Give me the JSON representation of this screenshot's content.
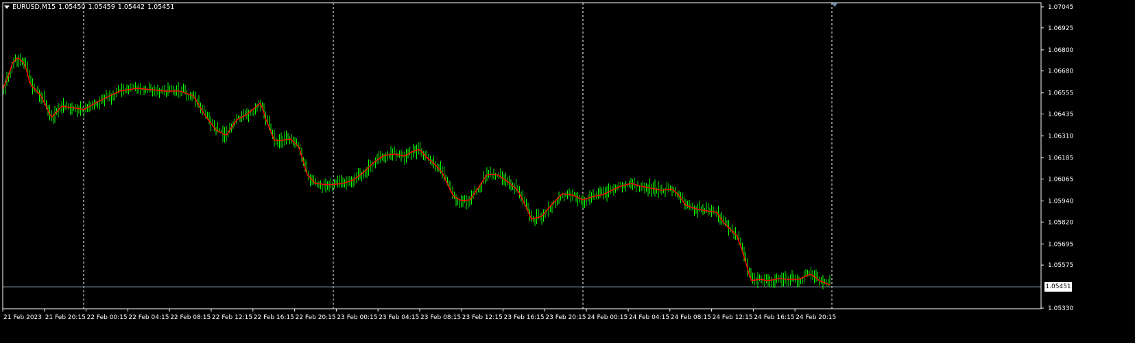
{
  "header": {
    "symbol": "EURUSD,M15",
    "open": "1.05450",
    "high": "1.05459",
    "low": "1.05442",
    "close": "1.05451"
  },
  "colors": {
    "background": "#000000",
    "candles": "#00ff00",
    "moving_average": "#ff0000",
    "grid": "#ffffff",
    "bid_line": "#778899"
  },
  "current_price": "1.05451",
  "price_axis": [
    "1.07045",
    "1.06925",
    "1.06800",
    "1.06680",
    "1.06555",
    "1.06435",
    "1.06310",
    "1.06185",
    "1.06065",
    "1.05940",
    "1.05820",
    "1.05695",
    "1.05575",
    "1.05451",
    "1.05330"
  ],
  "time_axis": [
    "21 Feb 2023",
    "21 Feb 20:15",
    "22 Feb 00:15",
    "22 Feb 04:15",
    "22 Feb 08:15",
    "22 Feb 12:15",
    "22 Feb 16:15",
    "22 Feb 20:15",
    "23 Feb 00:15",
    "23 Feb 04:15",
    "23 Feb 08:15",
    "23 Feb 12:15",
    "23 Feb 16:15",
    "23 Feb 20:15",
    "24 Feb 00:15",
    "24 Feb 04:15",
    "24 Feb 08:15",
    "24 Feb 12:15",
    "24 Feb 16:15",
    "24 Feb 20:15"
  ],
  "day_separators": [
    "22 Feb 00:00",
    "23 Feb 00:00",
    "24 Feb 00:00",
    "25 Feb 00:00"
  ],
  "chart_data": {
    "type": "line",
    "x": [
      "21 Feb 2023",
      "21 Feb 20:15",
      "22 Feb 00:15",
      "22 Feb 04:15",
      "22 Feb 08:15",
      "22 Feb 12:15",
      "22 Feb 16:15",
      "22 Feb 20:15",
      "23 Feb 00:15",
      "23 Feb 04:15",
      "23 Feb 08:15",
      "23 Feb 12:15",
      "23 Feb 16:15",
      "23 Feb 20:15",
      "24 Feb 00:15",
      "24 Feb 04:15",
      "24 Feb 08:15",
      "24 Feb 12:15",
      "24 Feb 16:15",
      "24 Feb 20:15"
    ],
    "series": [
      {
        "values": [
          1.0658,
          1.065,
          1.0645,
          1.0655,
          1.0657,
          1.0625,
          1.0648,
          1.0608,
          1.0605,
          1.0625,
          1.0618,
          1.06,
          1.0598,
          1.0595,
          1.06,
          1.0603,
          1.0595,
          1.0585,
          1.055,
          1.0551
        ]
      }
    ],
    "ylim": [
      1.0533,
      1.07045
    ],
    "grid": "off"
  }
}
